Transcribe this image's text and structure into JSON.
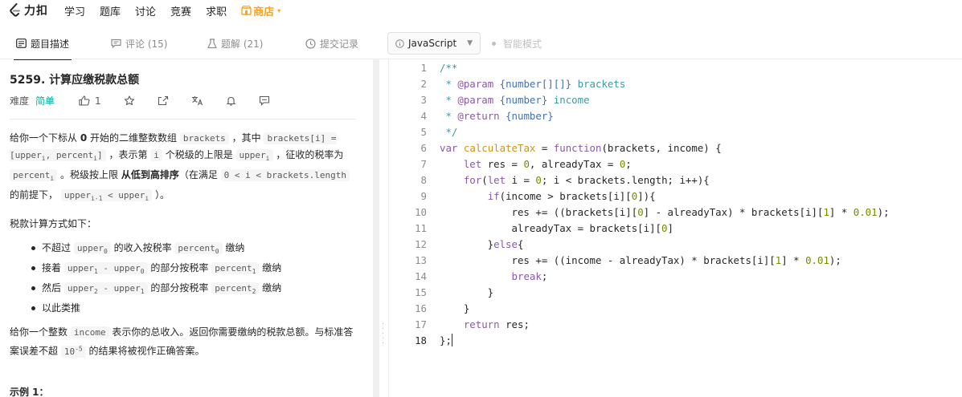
{
  "nav": {
    "logo_text": "力扣",
    "items": [
      "学习",
      "题库",
      "讨论",
      "竞赛",
      "求职"
    ],
    "store_label": "商店",
    "accent_color": "#ffa116"
  },
  "tabs": {
    "description": "题目描述",
    "comments": "评论 (15)",
    "solutions": "题解 (21)",
    "submissions": "提交记录",
    "language": "JavaScript",
    "smart_mode": "智能模式"
  },
  "problem": {
    "title": "5259. 计算应缴税款总额",
    "difficulty_label": "难度",
    "difficulty": "简单",
    "difficulty_color": "#00af9b",
    "likes": "1",
    "example_heading": "示例 1："
  },
  "editor": {
    "line_numbers": [
      "1",
      "2",
      "3",
      "4",
      "5",
      "6",
      "7",
      "8",
      "9",
      "10",
      "11",
      "12",
      "13",
      "14",
      "15",
      "16",
      "17",
      "18"
    ],
    "lines": [
      "/**",
      " * @param {number[][]} brackets",
      " * @param {number} income",
      " * @return {number}",
      " */",
      "var calculateTax = function(brackets, income) {",
      "    let res = 0, alreadyTax = 0;",
      "    for(let i = 0; i < brackets.length; i++){",
      "        if(income > brackets[i][0]){",
      "            res += ((brackets[i][0] - alreadyTax) * brackets[i][1] * 0.01);",
      "            alreadyTax = brackets[i][0]",
      "        }else{",
      "            res += ((income - alreadyTax) * brackets[i][1] * 0.01);",
      "            break;",
      "        }",
      "    }",
      "    return res;",
      "};"
    ]
  }
}
